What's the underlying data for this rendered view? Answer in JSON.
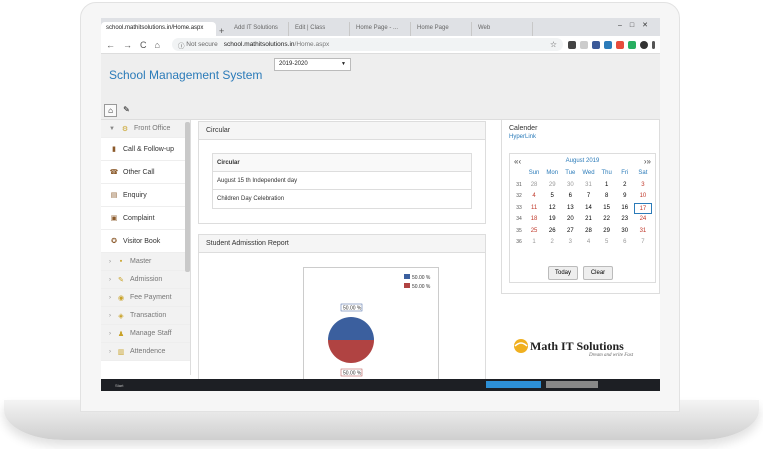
{
  "browser": {
    "active_tab": "school.mathitsolutions.in/Home.aspx",
    "tabs": [
      "Add IT Solutions",
      "Edit | Class",
      "Home Page - ...",
      "Home Page",
      "Web"
    ],
    "not_secure": "Not secure",
    "url_host": "school.mathitsolutions.in",
    "url_path": "/Home.aspx"
  },
  "app": {
    "title": "School Management System",
    "year": "2019-2020"
  },
  "sidebar": {
    "items": [
      {
        "label": "Front Office",
        "icon": "gear-icon",
        "group": true
      },
      {
        "label": "Call & Follow-up",
        "icon": "book-icon",
        "group": false
      },
      {
        "label": "Other Call",
        "icon": "phone-icon",
        "group": false
      },
      {
        "label": "Enquiry",
        "icon": "document-icon",
        "group": false
      },
      {
        "label": "Complaint",
        "icon": "clipboard-icon",
        "group": false
      },
      {
        "label": "Visitor Book",
        "icon": "visitor-icon",
        "group": false
      },
      {
        "label": "Master",
        "icon": "folder-icon",
        "group": true
      },
      {
        "label": "Admission",
        "icon": "pencil-icon",
        "group": true
      },
      {
        "label": "Fee Payment",
        "icon": "coin-icon",
        "group": true
      },
      {
        "label": "Transaction",
        "icon": "transaction-icon",
        "group": true
      },
      {
        "label": "Manage Staff",
        "icon": "staff-icon",
        "group": true
      },
      {
        "label": "Attendence",
        "icon": "bar-icon",
        "group": true
      }
    ]
  },
  "circular": {
    "title": "Circular",
    "header": "Circular",
    "rows": [
      "August 15 th Independent day",
      "Children Day Celebration"
    ]
  },
  "report": {
    "title": "Student Admisstion Report",
    "legend": [
      "50.00 %",
      "50.00 %"
    ],
    "label_top": "50.00 %",
    "label_bottom": "50.00 %",
    "colors": [
      "#3b5f9e",
      "#b04342"
    ]
  },
  "calendar": {
    "title": "Calender",
    "link": "HyperLink",
    "month": "August 2019",
    "days": [
      "Sun",
      "Mon",
      "Tue",
      "Wed",
      "Thu",
      "Fri",
      "Sat"
    ],
    "weeks": [
      {
        "wk": "31",
        "d": [
          "28",
          "29",
          "30",
          "31",
          "1",
          "2",
          "3"
        ]
      },
      {
        "wk": "32",
        "d": [
          "4",
          "5",
          "6",
          "7",
          "8",
          "9",
          "10"
        ]
      },
      {
        "wk": "33",
        "d": [
          "11",
          "12",
          "13",
          "14",
          "15",
          "16",
          "17"
        ]
      },
      {
        "wk": "34",
        "d": [
          "18",
          "19",
          "20",
          "21",
          "22",
          "23",
          "24"
        ]
      },
      {
        "wk": "35",
        "d": [
          "25",
          "26",
          "27",
          "28",
          "29",
          "30",
          "31"
        ]
      },
      {
        "wk": "36",
        "d": [
          "1",
          "2",
          "3",
          "4",
          "5",
          "6",
          "7"
        ]
      }
    ],
    "today_btn": "Today",
    "clear_btn": "Clear"
  },
  "logo": {
    "text": "Math IT Solutions",
    "tagline": "Dream and write Fast"
  },
  "taskbar": {
    "left": "Start"
  }
}
